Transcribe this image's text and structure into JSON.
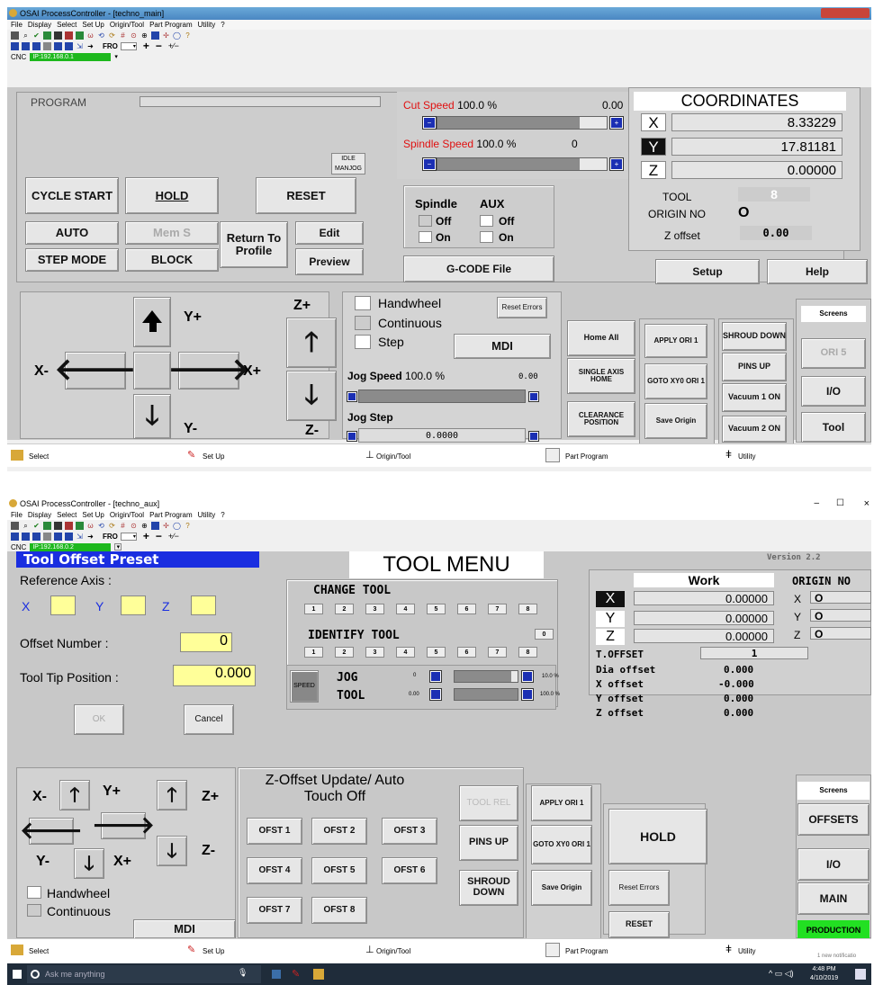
{
  "top": {
    "title": "OSAI ProcessController - [techno_main]",
    "menu": [
      "File",
      "Display",
      "Select",
      "Set Up",
      "Origin/Tool",
      "Part Program",
      "Utility",
      "?"
    ],
    "fro": "FRO",
    "cnc_label": "CNC",
    "ip": "IP:192.168.0.1",
    "program_label": "PROGRAM",
    "idle": "IDLE",
    "manjog": "MANJOG",
    "cycle_start": "CYCLE START",
    "hold": "HOLD",
    "reset": "RESET",
    "auto": "AUTO",
    "mem_s": "Mem S",
    "return_to_profile": "Return To Profile",
    "edit": "Edit",
    "step_mode": "STEP MODE",
    "block": "BLOCK",
    "preview": "Preview",
    "cut_speed_label": "Cut Speed",
    "cut_speed_value": "100.0 %",
    "cut_speed_level": 1.0,
    "cut_speed_readout": "0.00",
    "spindle_speed_label": "Spindle Speed",
    "spindle_speed_value": "100.0 %",
    "spindle_speed_level": 1.0,
    "spindle_speed_readout": "0",
    "spindle_label": "Spindle",
    "aux_label": "AUX",
    "off": "Off",
    "on": "On",
    "gcode_file": "G-CODE File",
    "coordinates_title": "COORDINATES",
    "x_axis": "X",
    "x_value": "8.33229",
    "y_axis": "Y",
    "y_value": "17.81181",
    "z_axis": "Z",
    "z_value": "0.00000",
    "tool_label": "TOOL",
    "tool_value": "8",
    "origin_label": "ORIGIN NO",
    "origin_value": "O",
    "zoffset_label": "Z offset",
    "zoffset_value": "0.00",
    "setup": "Setup",
    "help": "Help",
    "y_plus": "Y+",
    "y_minus": "Y-",
    "x_plus": "X+",
    "x_minus": "X-",
    "z_plus": "Z+",
    "z_minus": "Z-",
    "handwheel": "Handwheel",
    "continuous": "Continuous",
    "step": "Step",
    "reset_errors": "Reset Errors",
    "mdi": "MDI",
    "jog_speed_label": "Jog Speed",
    "jog_speed_value": "100.0 %",
    "jog_speed_level": 1.0,
    "jog_speed_readout": "0.00",
    "jog_step_label": "Jog Step",
    "jog_step_value": "0.0000",
    "home_all": "Home All",
    "single_axis_home": "SINGLE AXIS HOME",
    "clearance_position": "CLEARANCE POSITION",
    "apply_ori": "APPLY ORI 1",
    "goto_xy0": "GOTO XY0 ORI 1",
    "save_origin": "Save Origin",
    "shroud_down": "SHROUD DOWN",
    "pins_up": "PINS UP",
    "vacuum1": "Vacuum 1 ON",
    "vacuum2": "Vacuum 2 ON",
    "screens": "Screens",
    "ori5": "ORI 5",
    "io": "I/O",
    "tool_btn": "Tool",
    "status": [
      "Select",
      "Set Up",
      "Origin/Tool",
      "Part Program",
      "Utility"
    ]
  },
  "bottom": {
    "title": "OSAI ProcessController - [techno_aux]",
    "menu": [
      "File",
      "Display",
      "Select",
      "Set Up",
      "Origin/Tool",
      "Part Program",
      "Utility",
      "?"
    ],
    "fro": "FRO",
    "cnc_label": "CNC",
    "ip": "IP:192.168.0.2",
    "win_min": "–",
    "win_max": "☐",
    "win_close": "×",
    "preset_title": "Tool Offset Preset",
    "tool_menu": "TOOL MENU",
    "version": "Version 2.2",
    "reference_axis": "Reference Axis  :",
    "ref_x": "X",
    "ref_y": "Y",
    "ref_z": "Z",
    "offset_number_label": "Offset Number  :",
    "offset_number_value": "0",
    "tool_tip_label": "Tool Tip Position :",
    "tool_tip_value": "0.000",
    "ok": "OK",
    "cancel": "Cancel",
    "change_tool": "CHANGE TOOL",
    "identify_tool": "IDENTIFY TOOL",
    "tool_numbers": [
      "1",
      "2",
      "3",
      "4",
      "5",
      "6",
      "7",
      "8"
    ],
    "identify_zero": "0",
    "speed": "SPEED",
    "jog": "JOG",
    "jog_small": "0",
    "jog_pct": "10.0 %",
    "jog_level": 0.1,
    "tool": "TOOL",
    "tool_small": "0.00",
    "tool_pct": "100.0 %",
    "tool_level": 1.0,
    "work": "Work",
    "x_axis": "X",
    "x_value": "0.00000",
    "y_axis": "Y",
    "y_value": "0.00000",
    "z_axis": "Z",
    "z_value": "0.00000",
    "origin_no": "ORIGIN NO",
    "origin_x": "X",
    "origin_x_val": "O",
    "origin_y": "Y",
    "origin_y_val": "O",
    "origin_z": "Z",
    "origin_z_val": "O",
    "t_offset_label": "T.OFFSET",
    "t_offset_value": "1",
    "dia_offset_label": "Dia offset",
    "dia_offset_value": "0.000",
    "x_offset_label": "X offset",
    "x_offset_value": "-0.000",
    "y_offset_label": "Y offset",
    "y_offset_value": "0.000",
    "z_offset_label": "Z offset",
    "z_offset_value": "0.000",
    "x_minus": "X-",
    "y_plus": "Y+",
    "z_plus": "Z+",
    "z_minus": "Z-",
    "y_minus": "Y-",
    "x_plus": "X+",
    "handwheel": "Handwheel",
    "continuous": "Continuous",
    "mdi": "MDI",
    "zofs_title": "Z-Offset Update/ Auto Touch Off",
    "ofst": [
      "OFST 1",
      "OFST 2",
      "OFST 3",
      "OFST 4",
      "OFST 5",
      "OFST 6",
      "OFST 7",
      "OFST 8"
    ],
    "tool_rel": "TOOL REL",
    "pins_up": "PINS UP",
    "shroud_down": "SHROUD DOWN",
    "apply_ori": "APPLY ORI 1",
    "goto_xy0": "GOTO XY0 ORI 1",
    "save_origin": "Save Origin",
    "hold": "HOLD",
    "reset_errors": "Reset Errors",
    "reset": "RESET",
    "screens": "Screens",
    "offsets": "OFFSETS",
    "io": "I/O",
    "main": "MAIN",
    "production": "PRODUCTION",
    "status": [
      "Select",
      "Set Up",
      "Origin/Tool",
      "Part Program",
      "Utility"
    ],
    "notification": "1 new notificatio"
  },
  "taskbar": {
    "search": "Ask me anything",
    "time": "4:48 PM",
    "date": "4/10/2019"
  }
}
